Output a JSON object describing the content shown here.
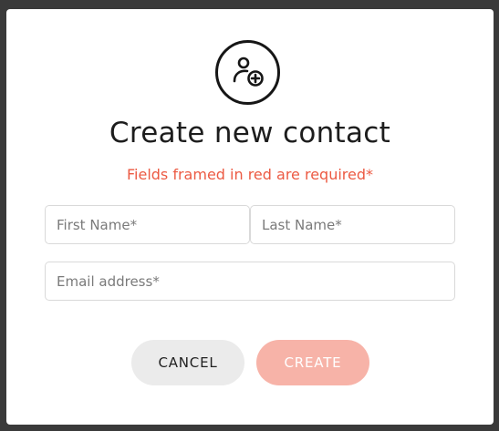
{
  "modal": {
    "title": "Create new contact",
    "subtitle": "Fields framed in red are required*",
    "icon": "add-user-icon"
  },
  "form": {
    "first_name_placeholder": "First Name*",
    "last_name_placeholder": "Last Name*",
    "email_placeholder": "Email address*"
  },
  "actions": {
    "cancel_label": "CANCEL",
    "create_label": "CREATE"
  },
  "colors": {
    "accent": "#ec5a43",
    "create_button": "#f7b3a8",
    "cancel_button": "#ebebeb"
  }
}
